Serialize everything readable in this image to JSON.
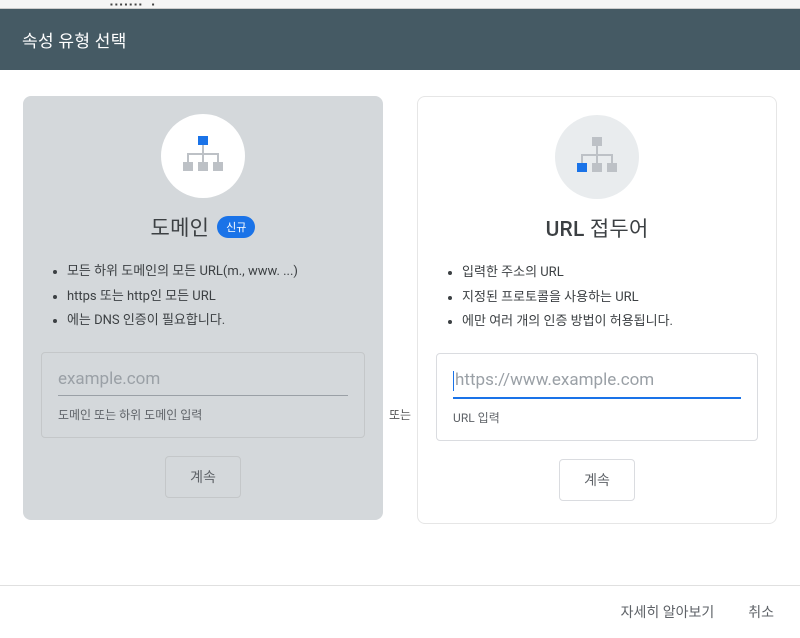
{
  "header": {
    "title": "속성 유형 선택"
  },
  "divider": "또는",
  "domain_card": {
    "title": "도메인",
    "badge": "신규",
    "bullets": [
      "모든 하위 도메인의 모든 URL(m., www. ...)",
      "https 또는 http인 모든 URL",
      "에는 DNS 인증이 필요합니다."
    ],
    "placeholder": "example.com",
    "helper": "도메인 또는 하위 도메인 입력",
    "continue": "계속"
  },
  "url_prefix_card": {
    "title": "URL 접두어",
    "bullets": [
      "입력한 주소의 URL",
      "지정된 프로토콜을 사용하는 URL",
      "에만 여러 개의 인증 방법이 허용됩니다."
    ],
    "placeholder": "https://www.example.com",
    "helper": "URL 입력",
    "continue": "계속"
  },
  "footer": {
    "learn_more": "자세히 알아보기",
    "cancel": "취소"
  }
}
